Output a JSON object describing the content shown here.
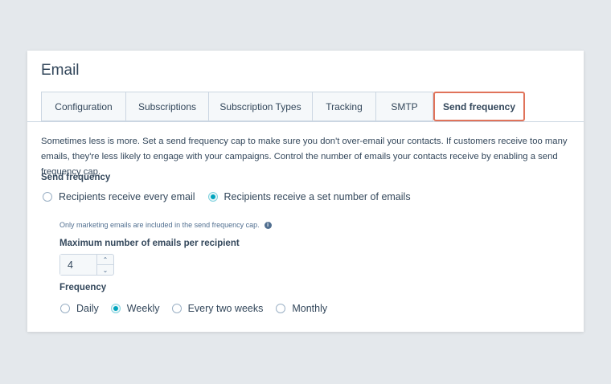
{
  "page": {
    "title": "Email"
  },
  "tabs": [
    {
      "label": "Configuration"
    },
    {
      "label": "Subscriptions"
    },
    {
      "label": "Subscription Types"
    },
    {
      "label": "Tracking"
    },
    {
      "label": "SMTP"
    },
    {
      "label": "Send frequency",
      "active": true
    }
  ],
  "description": "Sometimes less is more. Set a send frequency cap to make sure you don't over-email your contacts. If customers receive too many emails, they're less likely to engage with your campaigns. Control the number of emails your contacts receive by enabling a send frequency cap.",
  "send_frequency": {
    "label": "Send frequency",
    "options": [
      {
        "label": "Recipients receive every email",
        "checked": false
      },
      {
        "label": "Recipients receive a set number of emails",
        "checked": true
      }
    ]
  },
  "help_text": "Only marketing emails are included in the send frequency cap.",
  "max_emails": {
    "label": "Maximum number of emails per recipient",
    "value": "4"
  },
  "frequency": {
    "label": "Frequency",
    "options": [
      {
        "label": "Daily",
        "checked": false
      },
      {
        "label": "Weekly",
        "checked": true
      },
      {
        "label": "Every two weeks",
        "checked": false
      },
      {
        "label": "Monthly",
        "checked": false
      }
    ]
  },
  "colors": {
    "accent": "#00a4bd",
    "highlight": "#e0735a",
    "text": "#33475b"
  }
}
